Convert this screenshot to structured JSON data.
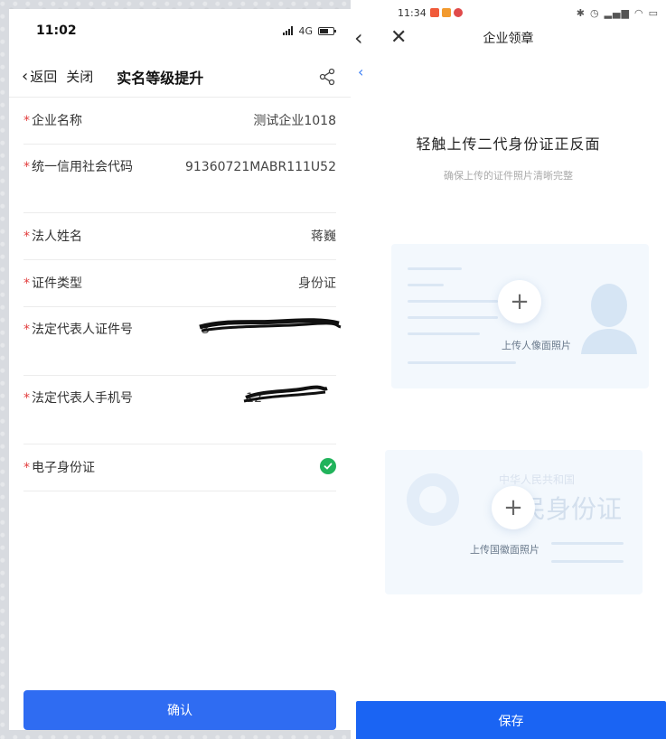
{
  "left": {
    "status": {
      "time": "11:02",
      "network": "4G"
    },
    "nav": {
      "back": "返回",
      "close": "关闭",
      "title": "实名等级提升"
    },
    "fields": [
      {
        "label": "企业名称",
        "value": "测试企业1018"
      },
      {
        "label": "统一信用社会代码",
        "value": "91360721MABR111U52"
      },
      {
        "label": "法人姓名",
        "value": "蒋巍"
      },
      {
        "label": "证件类型",
        "value": "身份证"
      },
      {
        "label": "法定代表人证件号",
        "value": "3"
      },
      {
        "label": "法定代表人手机号",
        "value": "12"
      },
      {
        "label": "电子身份证",
        "value": ""
      }
    ],
    "confirm_label": "确认",
    "colors": {
      "primary": "#2f6cf2",
      "required": "#e23c3c",
      "verified": "#21b35b"
    }
  },
  "right": {
    "status": {
      "time": "11:34"
    },
    "nav": {
      "title": "企业领章"
    },
    "upload": {
      "title": "轻触上传二代身份证正反面",
      "subtitle": "确保上传的证件照片清晰完整",
      "front_caption": "上传人像面照片",
      "back_caption": "上传国徽面照片",
      "back_heading": "中华人民共和国",
      "back_big": "民身份证"
    },
    "save_label": "保存",
    "colors": {
      "primary": "#1a64f3"
    }
  }
}
